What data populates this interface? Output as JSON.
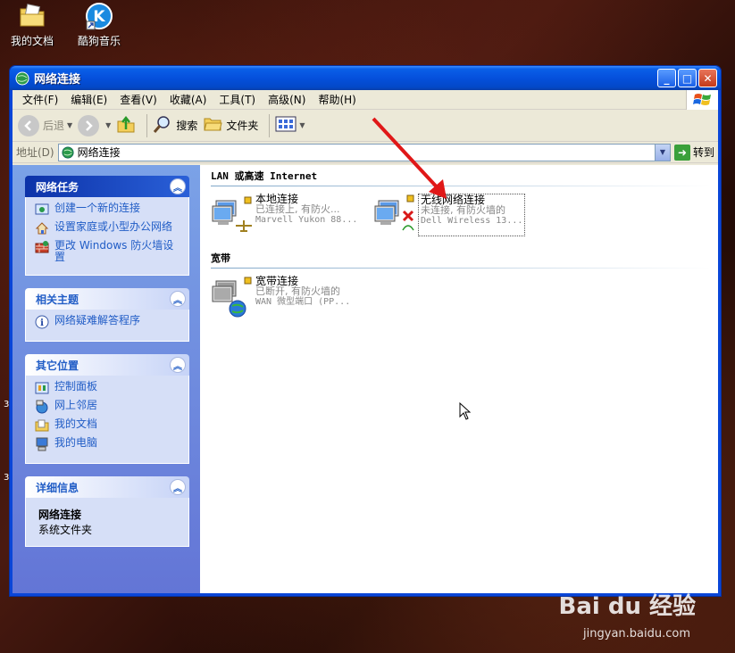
{
  "desktop": {
    "icons": [
      {
        "label": "我的文档",
        "icon": "my-documents-icon"
      },
      {
        "label": "酷狗音乐",
        "icon": "kugou-music-icon"
      }
    ],
    "edge_numbers": [
      "3",
      "3"
    ]
  },
  "window": {
    "title": "网络连接",
    "menu": [
      "文件(F)",
      "编辑(E)",
      "查看(V)",
      "收藏(A)",
      "工具(T)",
      "高级(N)",
      "帮助(H)"
    ],
    "toolbar": {
      "back_label": "后退",
      "search_label": "搜索",
      "folders_label": "文件夹"
    },
    "address": {
      "label": "地址(D)",
      "value": "网络连接",
      "go_label": "转到"
    }
  },
  "taskpane": {
    "network_tasks": {
      "title": "网络任务",
      "items": [
        "创建一个新的连接",
        "设置家庭或小型办公网络",
        "更改 Windows 防火墙设置"
      ]
    },
    "related": {
      "title": "相关主题",
      "items": [
        "网络疑难解答程序"
      ]
    },
    "other_places": {
      "title": "其它位置",
      "items": [
        "控制面板",
        "网上邻居",
        "我的文档",
        "我的电脑"
      ]
    },
    "details": {
      "title": "详细信息",
      "name": "网络连接",
      "type": "系统文件夹"
    }
  },
  "main": {
    "lan_group": {
      "title": "LAN 或高速 Internet",
      "connections": [
        {
          "name": "本地连接",
          "status": "已连接上, 有防火...",
          "device": "Marvell Yukon 88..."
        },
        {
          "name": "无线网络连接",
          "status": "未连接, 有防火墙的",
          "device": "Dell Wireless 13..."
        }
      ]
    },
    "broadband_group": {
      "title": "宽带",
      "connections": [
        {
          "name": "宽带连接",
          "status": "已断开, 有防火墙的",
          "device": "WAN 微型端口 (PP..."
        }
      ]
    }
  },
  "watermark": {
    "brand": "Bai du 经验",
    "url": "jingyan.baidu.com"
  },
  "colors": {
    "titlebar": "#0550dc",
    "task_link": "#215dc6",
    "annotation_arrow": "#e01818"
  }
}
